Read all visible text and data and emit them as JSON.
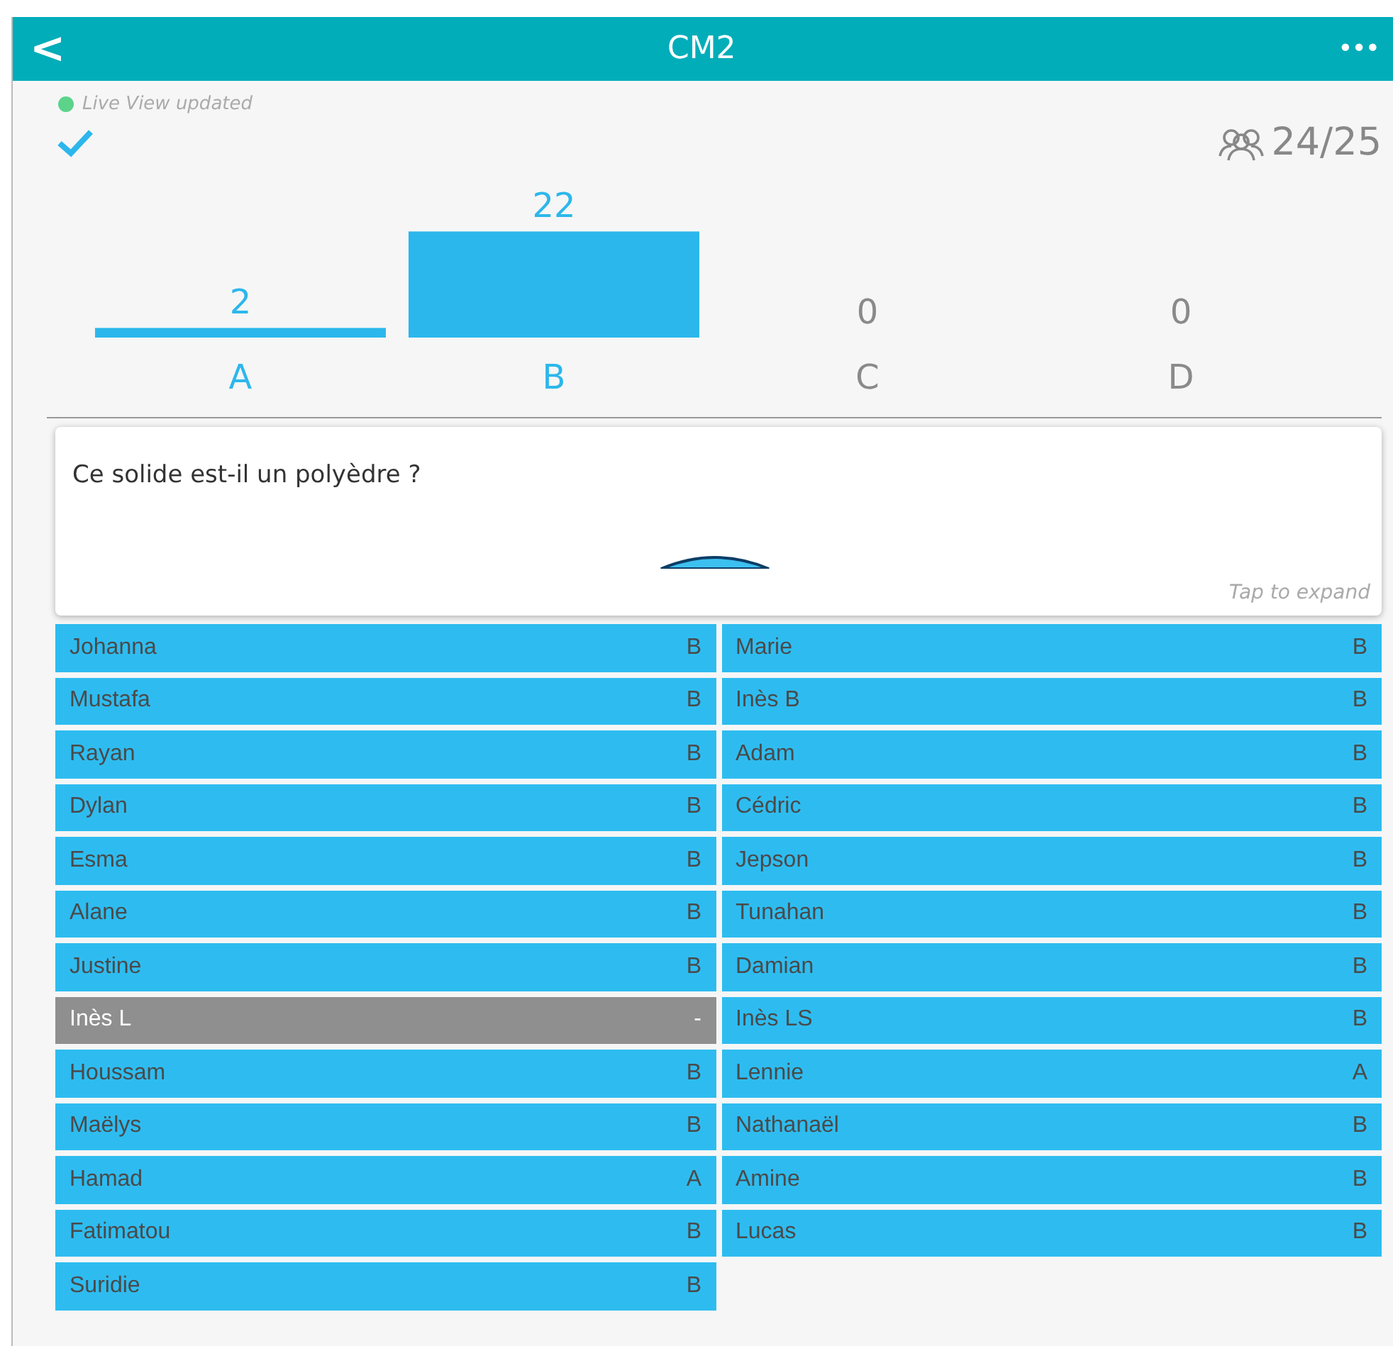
{
  "header": {
    "back": "<",
    "title": "CM2",
    "more": "•••"
  },
  "status": {
    "text": "Live View updated"
  },
  "participants": "24/25",
  "chart_data": {
    "type": "bar",
    "categories": [
      "A",
      "B",
      "C",
      "D"
    ],
    "values": [
      2,
      22,
      0,
      0
    ],
    "data_labels": true
  },
  "question": {
    "text": "Ce solide est-il un polyèdre ?",
    "hint": "Tap to expand"
  },
  "students": {
    "left_column": [
      {
        "name": "Johanna",
        "answer": "B",
        "answered": true
      },
      {
        "name": "Mustafa",
        "answer": "B",
        "answered": true
      },
      {
        "name": "Rayan",
        "answer": "B",
        "answered": true
      },
      {
        "name": "Dylan",
        "answer": "B",
        "answered": true
      },
      {
        "name": "Esma",
        "answer": "B",
        "answered": true
      },
      {
        "name": "Alane",
        "answer": "B",
        "answered": true
      },
      {
        "name": "Justine",
        "answer": "B",
        "answered": true
      },
      {
        "name": "Inès L",
        "answer": "-",
        "answered": false
      },
      {
        "name": "Houssam",
        "answer": "B",
        "answered": true
      },
      {
        "name": "Maëlys",
        "answer": "B",
        "answered": true
      },
      {
        "name": "Hamad",
        "answer": "A",
        "answered": true
      },
      {
        "name": "Fatimatou",
        "answer": "B",
        "answered": true
      },
      {
        "name": "Suridie",
        "answer": "B",
        "answered": true
      }
    ],
    "right_column": [
      {
        "name": "Marie",
        "answer": "B",
        "answered": true
      },
      {
        "name": "Inès B",
        "answer": "B",
        "answered": true
      },
      {
        "name": "Adam",
        "answer": "B",
        "answered": true
      },
      {
        "name": "Cédric",
        "answer": "B",
        "answered": true
      },
      {
        "name": "Jepson",
        "answer": "B",
        "answered": true
      },
      {
        "name": "Tunahan",
        "answer": "B",
        "answered": true
      },
      {
        "name": "Damian",
        "answer": "B",
        "answered": true
      },
      {
        "name": "Inès LS",
        "answer": "B",
        "answered": true
      },
      {
        "name": "Lennie",
        "answer": "A",
        "answered": true
      },
      {
        "name": "Nathanaël",
        "answer": "B",
        "answered": true
      },
      {
        "name": "Amine",
        "answer": "B",
        "answered": true
      },
      {
        "name": "Lucas",
        "answer": "B",
        "answered": true
      }
    ]
  }
}
